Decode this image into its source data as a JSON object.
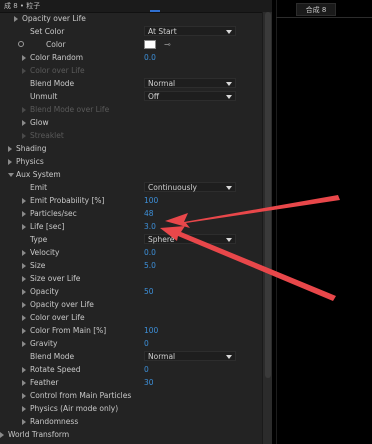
{
  "panel": {
    "header": "成 8 • 粒子",
    "rows": [
      {
        "label": "Opacity over Life",
        "indent": 22,
        "arrow": true
      },
      {
        "label": "Set Color",
        "indent": 30,
        "control": "dropdown",
        "value": "At Start"
      },
      {
        "label": "Color",
        "indent": 32,
        "clock": true,
        "control": "swatch",
        "value": "⊸"
      },
      {
        "label": "Color Random",
        "indent": 30,
        "arrow": true,
        "control": "number",
        "value": "0.0"
      },
      {
        "label": "Color over Life",
        "indent": 30,
        "arrow": true,
        "dim": true
      },
      {
        "label": "Blend Mode",
        "indent": 30,
        "control": "dropdown",
        "value": "Normal"
      },
      {
        "label": "Unmult",
        "indent": 30,
        "control": "dropdown",
        "value": "Off"
      },
      {
        "label": "Blend Mode over Life",
        "indent": 30,
        "arrow": true,
        "dim": true
      },
      {
        "label": "Glow",
        "indent": 30,
        "arrow": true
      },
      {
        "label": "Streaklet",
        "indent": 30,
        "arrow": true,
        "dim": true
      },
      {
        "label": "Shading",
        "indent": 16,
        "arrow": true
      },
      {
        "label": "Physics",
        "indent": 16,
        "arrow": true
      },
      {
        "label": "Aux System",
        "indent": 16,
        "arrow": true,
        "expanded": true
      },
      {
        "label": "Emit",
        "indent": 30,
        "control": "dropdown",
        "value": "Continuously"
      },
      {
        "label": "Emit Probability [%]",
        "indent": 30,
        "arrow": true,
        "control": "number",
        "value": "100"
      },
      {
        "label": "Particles/sec",
        "indent": 30,
        "arrow": true,
        "control": "number",
        "value": "48"
      },
      {
        "label": "Life [sec]",
        "indent": 30,
        "arrow": true,
        "control": "number",
        "value": "3.0"
      },
      {
        "label": "Type",
        "indent": 30,
        "control": "dropdown",
        "value": "Sphere"
      },
      {
        "label": "Velocity",
        "indent": 30,
        "arrow": true,
        "control": "number",
        "value": "0.0"
      },
      {
        "label": "Size",
        "indent": 30,
        "arrow": true,
        "control": "number",
        "value": "5.0"
      },
      {
        "label": "Size over Life",
        "indent": 30,
        "arrow": true
      },
      {
        "label": "Opacity",
        "indent": 30,
        "arrow": true,
        "control": "number",
        "value": "50"
      },
      {
        "label": "Opacity over Life",
        "indent": 30,
        "arrow": true
      },
      {
        "label": "Color over Life",
        "indent": 30,
        "arrow": true
      },
      {
        "label": "Color From Main [%]",
        "indent": 30,
        "arrow": true,
        "control": "number",
        "value": "100"
      },
      {
        "label": "Gravity",
        "indent": 30,
        "arrow": true,
        "control": "number",
        "value": "0"
      },
      {
        "label": "Blend Mode",
        "indent": 30,
        "control": "dropdown",
        "value": "Normal"
      },
      {
        "label": "Rotate Speed",
        "indent": 30,
        "arrow": true,
        "control": "number",
        "value": "0"
      },
      {
        "label": "Feather",
        "indent": 30,
        "arrow": true,
        "control": "number",
        "value": "30"
      },
      {
        "label": "Control from Main Particles",
        "indent": 30,
        "arrow": true
      },
      {
        "label": "Physics (Air mode only)",
        "indent": 30,
        "arrow": true
      },
      {
        "label": "Randomness",
        "indent": 30,
        "arrow": true
      },
      {
        "label": "World Transform",
        "indent": 8,
        "arrow": true
      }
    ]
  },
  "comp_tab": "合成 8",
  "colors": {
    "panel_bg": "#232323",
    "value_blue": "#3d8fd8",
    "annotation_red": "#e8474a"
  }
}
